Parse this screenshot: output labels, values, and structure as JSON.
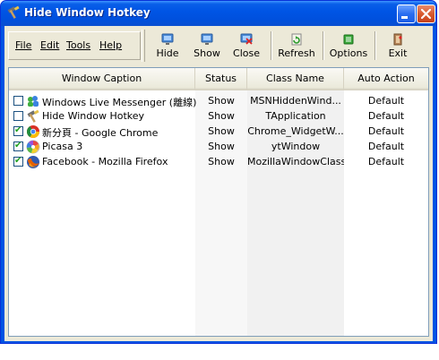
{
  "window": {
    "title": "Hide Window Hotkey"
  },
  "menu": {
    "items": [
      {
        "label": "File"
      },
      {
        "label": "Edit"
      },
      {
        "label": "Tools"
      },
      {
        "label": "Help"
      }
    ]
  },
  "toolbar": {
    "buttons": [
      {
        "label": "Hide",
        "icon": "monitor-icon"
      },
      {
        "label": "Show",
        "icon": "monitor-icon"
      },
      {
        "label": "Close",
        "icon": "close-window-icon"
      },
      {
        "label": "Refresh",
        "icon": "refresh-icon"
      },
      {
        "label": "Options",
        "icon": "options-icon"
      },
      {
        "label": "Exit",
        "icon": "exit-icon"
      }
    ]
  },
  "list": {
    "columns": [
      "Window Caption",
      "Status",
      "Class Name",
      "Auto Action"
    ],
    "rows": [
      {
        "checked": false,
        "caption": "Windows Live Messenger (離線)",
        "status": "Show",
        "class_name": "MSNHiddenWind...",
        "auto_action": "Default",
        "icon": "messenger-icon"
      },
      {
        "checked": false,
        "caption": "Hide Window Hotkey",
        "status": "Show",
        "class_name": "TApplication",
        "auto_action": "Default",
        "icon": "hammer-icon"
      },
      {
        "checked": true,
        "caption": "新分頁 - Google Chrome",
        "status": "Show",
        "class_name": "Chrome_WidgetW...",
        "auto_action": "Default",
        "icon": "chrome-icon"
      },
      {
        "checked": true,
        "caption": "Picasa 3",
        "status": "Show",
        "class_name": "ytWindow",
        "auto_action": "Default",
        "icon": "picasa-icon"
      },
      {
        "checked": true,
        "caption": "Facebook - Mozilla Firefox",
        "status": "Show",
        "class_name": "MozillaWindowClass",
        "auto_action": "Default",
        "icon": "firefox-icon"
      }
    ]
  },
  "colors": {
    "titlebar": "#0054e3",
    "client": "#ece9d8",
    "close_button": "#d85a2f"
  }
}
